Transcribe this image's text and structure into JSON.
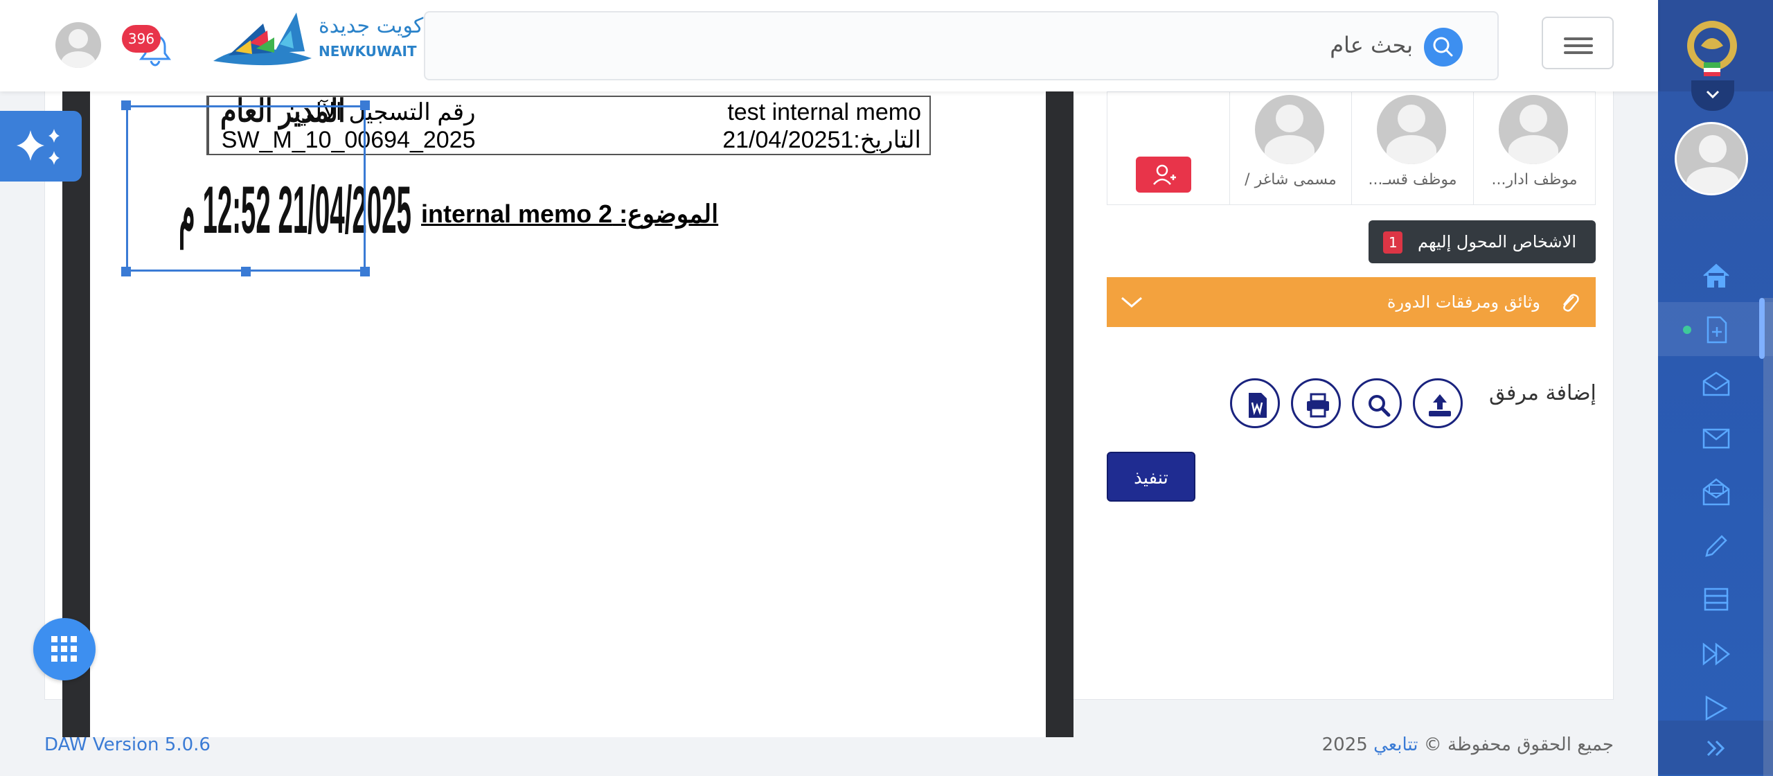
{
  "header": {
    "search_placeholder": "بحث عام",
    "notification_count": "396",
    "logo_text_ar": "كويت جديدة",
    "logo_text_en": "NEWKUWAIT"
  },
  "document": {
    "cell_memo_title": "test internal memo",
    "cell_date": "التاريخ:21/04/2025",
    "cell_date_prefix": "1",
    "cell_reg_label": "رقم التسجيل الآلي:",
    "cell_reg_value": "SW_M_10_00694_2025",
    "subject": "الموضوع: internal memo 2",
    "stamp_title": "المدير العام",
    "stamp_date": "21/04/2025 12:52 م"
  },
  "panel": {
    "assignees": [
      {
        "name": "موظف ادار..."
      },
      {
        "name": "موظف قسـ..."
      },
      {
        "name": "مسمى شاغر /"
      }
    ],
    "transferred_label": "الاشخاص المحول إليهم",
    "transferred_count": "1",
    "docs_bar_label": "وثائق ومرفقات الدورة",
    "add_attachment_label": "إضافة مرفق",
    "execute_label": "تنفيذ"
  },
  "footer": {
    "version": "DAW Version 5.0.6",
    "copyright_prefix": "جميع الحقوق محفوظة ©",
    "copyright_brand": "تتابعي",
    "copyright_year": "2025"
  },
  "colors": {
    "sidebar": "#2c5fb6",
    "accent_blue": "#3d8ff0",
    "orange": "#f3a23e",
    "danger": "#e8344a",
    "navy": "#1f2c91"
  },
  "icons": [
    "search-icon",
    "menu-icon",
    "bell-icon",
    "home-icon",
    "new-document-icon",
    "inbox-icon",
    "mail-icon",
    "mail-open-icon",
    "edit-icon",
    "archive-icon",
    "fast-forward-icon",
    "play-icon",
    "expand-icon",
    "upload-icon",
    "magnify-icon",
    "print-icon",
    "word-icon",
    "paperclip-icon",
    "chevron-down-icon",
    "add-user-icon",
    "sparkle-icon",
    "apps-grid-icon"
  ]
}
